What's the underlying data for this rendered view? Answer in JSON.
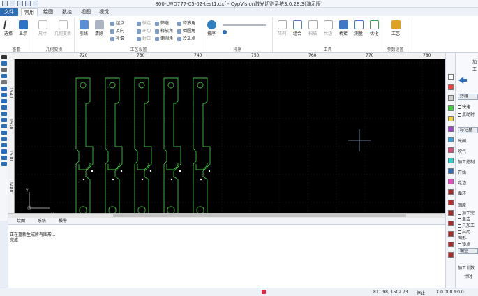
{
  "window": {
    "title": "800-LWD777-05-02-test1.dxf - CypVision激光切割系统3.0.28.3(演示版)"
  },
  "tabs": [
    "文件",
    "常用",
    "绘图",
    "数控",
    "视图",
    "视觉"
  ],
  "ribbon": {
    "select_label": "选择",
    "display_label": "显示",
    "group_view": "查看",
    "size_label": "尺寸",
    "geo_transform_label": "几何变换",
    "group_geo": "几何变换",
    "lead_label": "引线",
    "clear_label": "清除",
    "start_label": "起点",
    "micro_joint_label": "微连",
    "unseal_label": "封口",
    "reverse_label": "反向",
    "compensate_label": "补偿",
    "cooling_point_label": "冷却点",
    "ring_cut_label": "环切",
    "release_angle_label": "释放角",
    "chamfer_label": "倒圆角",
    "cold_corner_label": "冷却点",
    "filter_label": "筛选",
    "group_process": "工艺设置",
    "sort_label": "排序",
    "group_sort": "排序",
    "array_label": "阵列",
    "combine_label": "组合",
    "scan_label": "扫描",
    "common_edge_label": "共边",
    "bridge_label": "桥接",
    "measure_label": "测量",
    "optimize_label": "优化",
    "group_tools": "工具",
    "process_label": "工艺",
    "group_params": "参数设置"
  },
  "canvas": {
    "ruler_top_labels": [
      "720",
      "730",
      "740",
      "750",
      "760",
      "770",
      "780"
    ],
    "ruler_left_labels": [
      "1540",
      "1520",
      "1500",
      "1480"
    ],
    "axis_x": "X",
    "axis_y": "Y"
  },
  "bottom_tabs": [
    "绘图",
    "系统",
    "报警"
  ],
  "log_lines": [
    "正在重新生成所有图形...",
    "完成"
  ],
  "status": {
    "coords": "811.98, 1502.73",
    "state": "停止",
    "xy": "X:0.000 Y:0.0"
  },
  "right_panel": {
    "v_labels": [
      "加",
      "工"
    ],
    "reverse_btn": "转租",
    "fast_label": "快速",
    "pointcut_label": "点动射",
    "mark_label": "标记星",
    "laser_label": "光闸",
    "spray_label": "吹气",
    "control_label": "加工控制",
    "start_label": "开始",
    "walk_label": "走边",
    "loop_label": "循环",
    "back_label": "回原",
    "finish_label": "加工完",
    "single_label": "单击",
    "only_label": "只加工",
    "enable_label": "启用",
    "graphics_label": "图形、",
    "lock_label": "锁点",
    "exit_label": "编空",
    "count_label": "加工计数",
    "time_label": "计时"
  },
  "colors": {
    "part_green": "#3fbf3f",
    "canvas_bg": "#000000",
    "file_tab": "#2b6cb3"
  }
}
